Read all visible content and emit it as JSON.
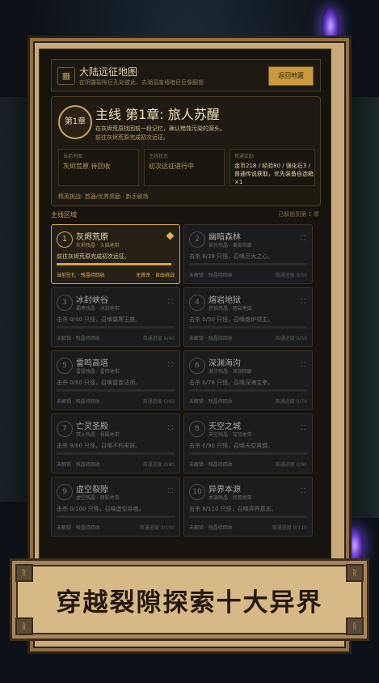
{
  "header": {
    "title": "大陆远征地图",
    "subtitle": "在阴霾裂隙巨孔处彼此，去潮湿废墟暗巨巨像翻锁",
    "back_button": "返回地面"
  },
  "main_quest": {
    "badge": "第1章",
    "title": "主线  第1章: 旅人苏醒",
    "desc_line1": "在灰烬荒原找回前一段记忆，确认黯蚀污染的源头。",
    "desc_line2": "前往灰烬荒原完成初次远征。",
    "boxes": [
      {
        "label": "当前地图",
        "value": "灰烬荒原 待回收"
      },
      {
        "label": "主线状态",
        "value": "初次远征进行中"
      },
      {
        "label": "首通奖励",
        "value": "金币218 / 经验80 / 强化石3 / 普通传说获取，优先装备自选箱×1"
      }
    ],
    "footer": "精英挑战: 首通/优秀奖励 · 新手剧场"
  },
  "section": {
    "title": "主线区域",
    "progress": "已解锁到第 1 章"
  },
  "regions": [
    {
      "num": "1",
      "name": "灰烬荒原",
      "sub": "灰烬残晶 · 火焰地带",
      "desc": "前往灰烬荒原完成初次远征。",
      "f1": "当前驻扎 · 残晶待回收",
      "f2": "无首杀 · 自由挑战",
      "locked": false,
      "progress": 0.97
    },
    {
      "num": "2",
      "name": "幽暗森林",
      "sub": "苔光残晶 · 毒雾回廊",
      "desc": "击杀 8/38 只怪，召唤巨大之心。",
      "f1": "未解锁 · 残晶待回收",
      "f2": "首通进度 0/50",
      "locked": true,
      "progress": 0.0
    },
    {
      "num": "3",
      "name": "冰封峡谷",
      "sub": "霜寒残晶 · 冰封地带",
      "desc": "击杀 0/40 只怪，召唤霜寒王座。",
      "f1": "未解锁 · 残晶待回收",
      "f2": "首通进度 0/40",
      "locked": true,
      "progress": 0.0
    },
    {
      "num": "4",
      "name": "熔岩地狱",
      "sub": "炽焰残晶 · 熔岩地狱",
      "desc": "击杀 0/50 只怪，召唤熔炉领主。",
      "f1": "未解锁 · 残晶待回收",
      "f2": "首通进度 0/50",
      "locked": true,
      "progress": 0.0
    },
    {
      "num": "5",
      "name": "雷鸣高塔",
      "sub": "雷霆残晶 · 雷鸣地带",
      "desc": "击杀 0/60 只怪，召唤雷霆法师。",
      "f1": "未解锁 · 残晶待回收",
      "f2": "首通进度 0/60",
      "locked": true,
      "progress": 0.0
    },
    {
      "num": "6",
      "name": "深渊海沟",
      "sub": "潮汐残晶 · 深渊回廊",
      "desc": "击杀 0/78 只怪，召唤深海主宰。",
      "f1": "未解锁 · 残晶待回收",
      "f2": "首通进度 0/70",
      "locked": true,
      "progress": 0.0
    },
    {
      "num": "7",
      "name": "亡灵圣殿",
      "sub": "冥火残晶 · 骨殿地带",
      "desc": "击杀 9/80 只怪，召唤不朽巫妖。",
      "f1": "未解锁 · 残晶待回收",
      "f2": "首通进度 0/80",
      "locked": true,
      "progress": 0.0
    },
    {
      "num": "8",
      "name": "天空之城",
      "sub": "天空残晶 · 穹顶地带",
      "desc": "击杀 0/90 只怪，召唤天空男爵。",
      "f1": "未解锁 · 残晶待回收",
      "f2": "首通进度 0/90",
      "locked": true,
      "progress": 0.0
    },
    {
      "num": "9",
      "name": "虚空裂隙",
      "sub": "虚空残晶 · 暗影地带",
      "desc": "击杀 0/100 只怪，召唤虚空吞噬。",
      "f1": "未解锁 · 残晶待回收",
      "f2": "首通进度 0/100",
      "locked": true,
      "progress": 0.0
    },
    {
      "num": "10",
      "name": "异界本源",
      "sub": "本源残晶 · 终焉地带",
      "desc": "击杀 8/110 只怪，召唤异界意志。",
      "f1": "未解锁 · 残晶待回收",
      "f2": "首通进度 0/110",
      "locked": true,
      "progress": 0.0
    }
  ],
  "banner": {
    "text": "穿越裂隙探索十大异界",
    "corner_glyph": "ᚱ"
  },
  "colors": {
    "accent_gold": "#d2a848",
    "panel_bg": "#17140f",
    "frame_parchment": "#c9a977"
  }
}
